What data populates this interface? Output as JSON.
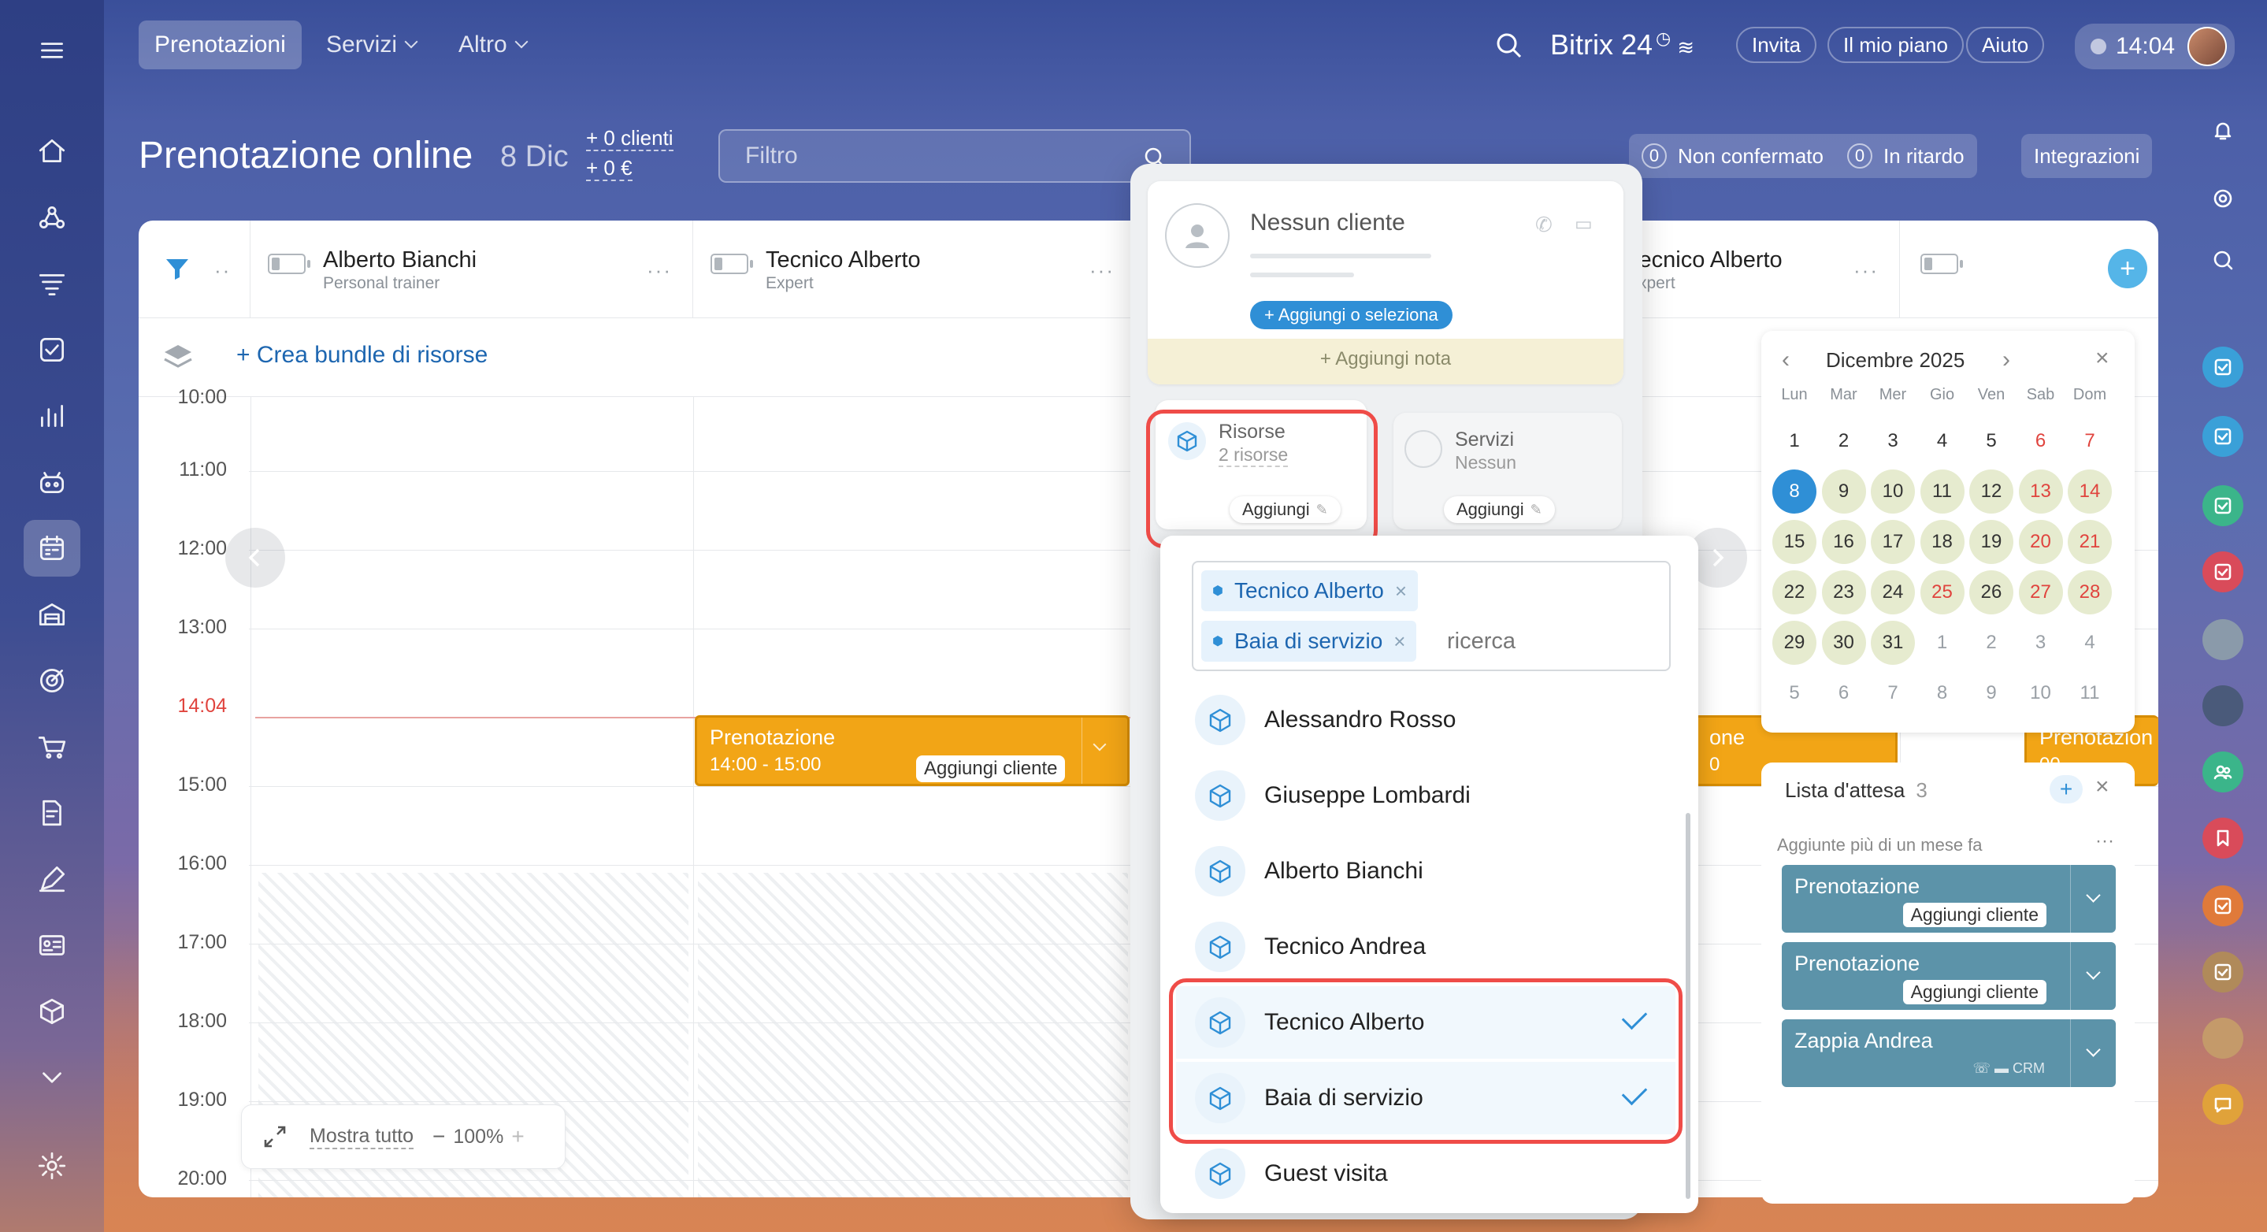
{
  "topnav": {
    "items": [
      {
        "label": "Prenotazioni"
      },
      {
        "label": "Servizi"
      },
      {
        "label": "Altro"
      }
    ],
    "brand": "Bitrix 24",
    "invite": "Invita",
    "plan": "Il mio piano",
    "help": "Aiuto",
    "clock": "14:04"
  },
  "header": {
    "title": "Prenotazione online",
    "date": "8 Dic",
    "clients": "+ 0 clienti",
    "revenue": "+ 0 €",
    "filter_placeholder": "Filtro",
    "unconfirmed_count": "0",
    "unconfirmed": "Non confermato",
    "late_count": "0",
    "late": "In ritardo",
    "integrations": "Integrazioni"
  },
  "schedule": {
    "bundle_link": "+ Crea bundle di risorse",
    "resources": [
      {
        "name": "Alberto Bianchi",
        "role": "Personal trainer"
      },
      {
        "name": "Tecnico Alberto",
        "role": "Expert"
      },
      {
        "name": "Tecnico Alberto",
        "role": "Expert"
      }
    ],
    "hours": [
      "10:00",
      "11:00",
      "12:00",
      "13:00",
      "14:04",
      "15:00",
      "16:00",
      "17:00",
      "18:00",
      "19:00",
      "20:00"
    ],
    "now": "14:04",
    "booking": {
      "title": "Prenotazione",
      "time": "14:00 - 15:00",
      "add_client": "Aggiungi cliente"
    },
    "partial_booking_1": {
      "title": "one",
      "time": "0"
    },
    "partial_booking_2": {
      "title": "Prenotazion",
      "time": "00"
    },
    "show_all": "Mostra tutto",
    "zoom": "100%"
  },
  "popup": {
    "client": "Nessun cliente",
    "add_select": "+ Aggiungi o seleziona",
    "add_note": "+ Aggiungi nota",
    "resources_label": "Risorse",
    "resources_count": "2 risorse",
    "resources_add": "Aggiungi",
    "services_label": "Servizi",
    "services_value": "Nessun",
    "services_add": "Aggiungi"
  },
  "dropdown": {
    "tags": [
      "Tecnico Alberto",
      "Baia di servizio"
    ],
    "search_placeholder": "ricerca",
    "items": [
      {
        "label": "Alessandro Rosso",
        "selected": false
      },
      {
        "label": "Giuseppe Lombardi",
        "selected": false
      },
      {
        "label": "Alberto Bianchi",
        "selected": false
      },
      {
        "label": "Tecnico Andrea",
        "selected": false
      },
      {
        "label": "Tecnico Alberto",
        "selected": true
      },
      {
        "label": "Baia di servizio",
        "selected": true
      },
      {
        "label": "Guest visita",
        "selected": false
      }
    ]
  },
  "calendar": {
    "month": "Dicembre 2025",
    "weekdays": [
      "Lun",
      "Mar",
      "Mer",
      "Gio",
      "Ven",
      "Sab",
      "Dom"
    ],
    "weeks": [
      [
        "1",
        "2",
        "3",
        "4",
        "5",
        "6",
        "7"
      ],
      [
        "8",
        "9",
        "10",
        "11",
        "12",
        "13",
        "14"
      ],
      [
        "15",
        "16",
        "17",
        "18",
        "19",
        "20",
        "21"
      ],
      [
        "22",
        "23",
        "24",
        "25",
        "26",
        "27",
        "28"
      ],
      [
        "29",
        "30",
        "31",
        "1",
        "2",
        "3",
        "4"
      ],
      [
        "5",
        "6",
        "7",
        "8",
        "9",
        "10",
        "11"
      ]
    ],
    "today": "8"
  },
  "waitlist": {
    "title": "Lista d'attesa",
    "count": "3",
    "subtitle": "Aggiunte più di un mese fa",
    "cards": [
      {
        "title": "Prenotazione",
        "action": "Aggiungi cliente"
      },
      {
        "title": "Prenotazione",
        "action": "Aggiungi cliente"
      },
      {
        "title": "Zappia Andrea",
        "action": "CRM"
      }
    ]
  },
  "colors": {
    "accent": "#2f8fd6",
    "booking": "#f2a516",
    "waitlist_card": "#5c93a9",
    "highlight": "#ef4c48",
    "now_line": "#e0443e"
  }
}
